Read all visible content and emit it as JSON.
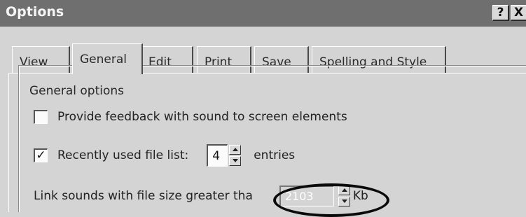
{
  "window": {
    "title": "Options",
    "help_label": "?",
    "close_label": "X"
  },
  "tabs": [
    {
      "label": "View",
      "active": false
    },
    {
      "label": "General",
      "active": true
    },
    {
      "label": "Edit",
      "active": false
    },
    {
      "label": "Print",
      "active": false
    },
    {
      "label": "Save",
      "active": false
    },
    {
      "label": "Spelling and Style",
      "active": false
    }
  ],
  "general_options": {
    "group_title": "General options",
    "feedback_sound": {
      "checked": false,
      "label": "Provide feedback with sound to screen elements"
    },
    "recent_files": {
      "checked": true,
      "check_glyph": "✓",
      "label": "Recently used file list:",
      "value": "4",
      "suffix": "entries"
    },
    "link_sounds": {
      "label": "Link sounds with file size greater tha",
      "value": "2103",
      "suffix": "Kb"
    }
  }
}
